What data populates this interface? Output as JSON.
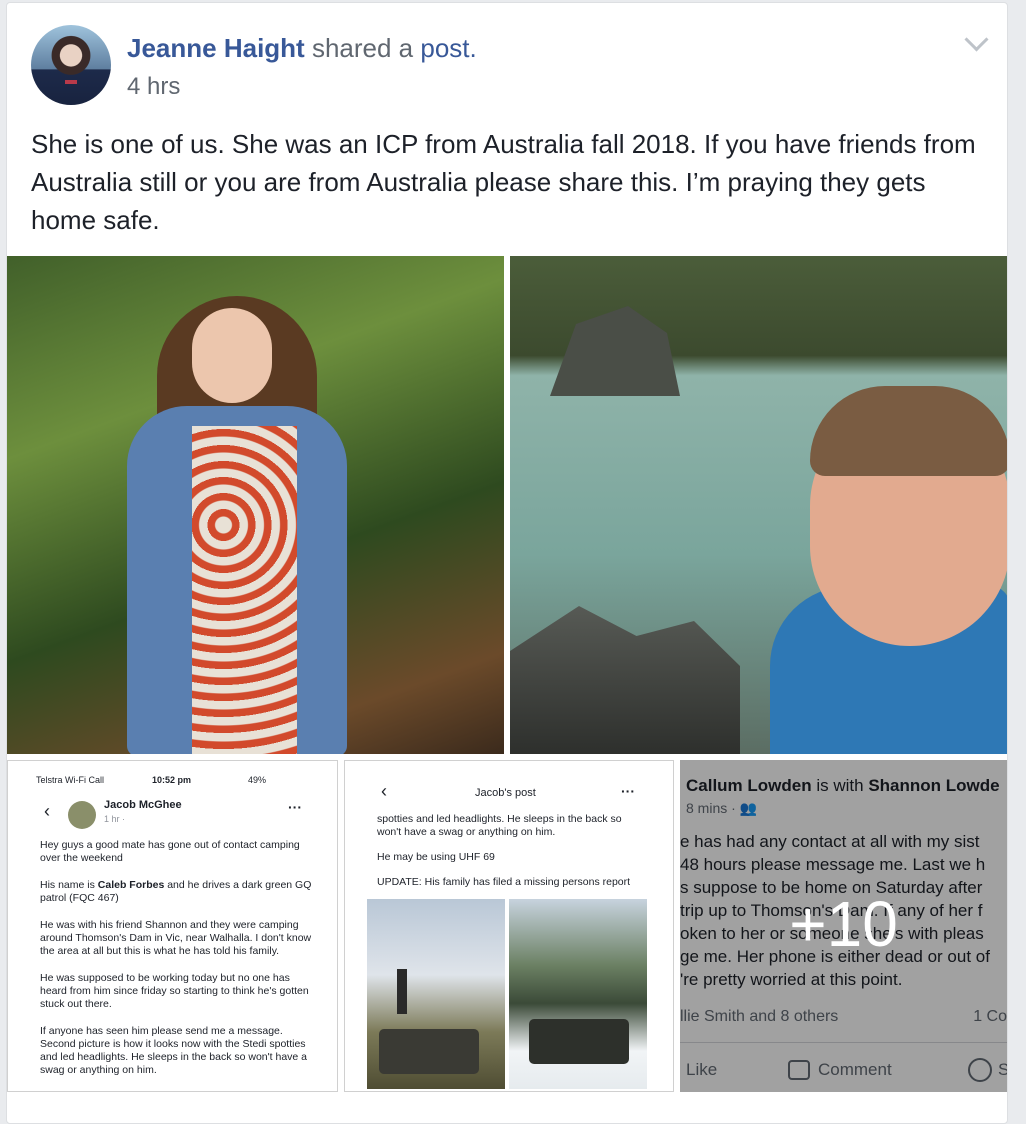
{
  "post": {
    "author": "Jeanne Haight",
    "action_text": "shared a",
    "action_link": "post.",
    "time": "4 hrs",
    "text": "She is one of us. She was an ICP from Australia fall 2018. If you have friends from Australia still or you are from Australia please share this. I’m praying they gets home safe.",
    "more_photos": "+10"
  },
  "screenshot1": {
    "status_left": "Telstra Wi-Fi Call",
    "time": "10:52 pm",
    "battery": "49%",
    "name": "Jacob McGhee",
    "meta": "1 hr ·",
    "p1": "Hey guys a good mate has gone out of contact camping over the weekend",
    "p2_pre": "His name is ",
    "p2_name": "Caleb Forbes",
    "p2_post": " and he drives a dark green GQ patrol (FQC 467)",
    "p3": "He was with his friend Shannon and they were camping around Thomson's Dam in Vic, near Walhalla. I don't know the area at all but this is what he has told his family.",
    "p4": "He was supposed to be working today but no one has heard from him since friday so starting to think he's gotten stuck out there.",
    "p5": "If anyone has seen him please send me a message. Second picture is how it looks now with the Stedi spotties and led headlights. He sleeps in the back so won't have a swag or anything on him."
  },
  "screenshot2": {
    "title": "Jacob's post",
    "p1": "spotties and led headlights. He sleeps in the back so won't have a swag or anything on him.",
    "p2": "He may be using UHF 69",
    "p3": "UPDATE: His family has filed a missing persons report"
  },
  "screenshot3": {
    "author": "Callum Lowden",
    "with": "is with",
    "tagged": "Shannon Lowde",
    "meta": "8 mins ·",
    "lines": [
      "e has had any contact at all with my sist",
      " 48 hours please message me. Last we h",
      "s suppose to be home on Saturday after",
      "trip up to Thomson's Dam. If any of her f",
      "oken to her or someone she's with pleas",
      "ge me. Her phone is either dead or out of",
      "'re pretty worried at this point."
    ],
    "reactions": "llie Smith and 8 others",
    "comments": "1 Co",
    "like": "Like",
    "comment": "Comment",
    "share": "S"
  }
}
